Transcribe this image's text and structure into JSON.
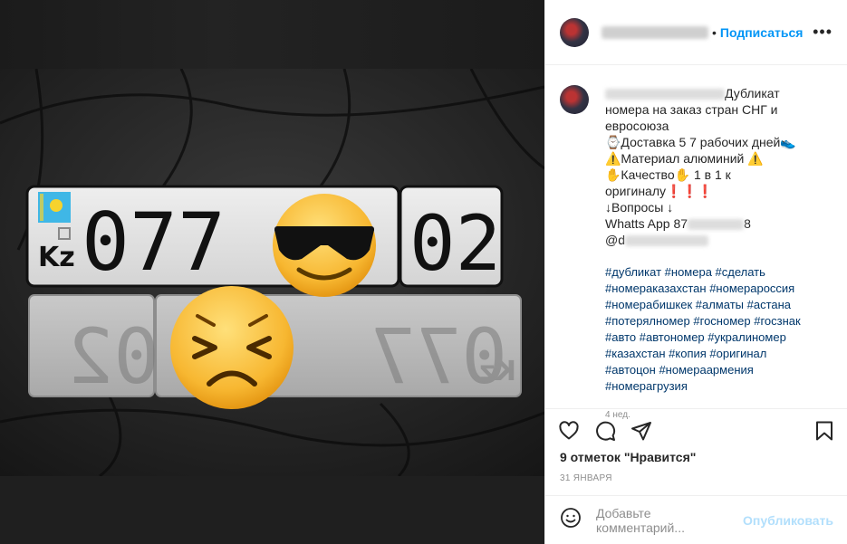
{
  "header": {
    "follow_label": "Подписаться",
    "more_label": "•••",
    "separator": "•"
  },
  "photo": {
    "plate_top_left": "Kz",
    "plate_top_main": "077",
    "plate_top_region": "02",
    "plate_bottom_main": "077",
    "plate_bottom_region": "02",
    "plate_bottom_country": "Kz",
    "emoji_top": "😎",
    "emoji_bottom": "😣"
  },
  "caption": {
    "line1": "Дубликат",
    "line2": "номера на заказ стран СНГ и",
    "line3": "евросоюза",
    "line4": "⌚Доставка 5 7 рабочих дней👟",
    "line5": "⚠️Материал алюминий ⚠️",
    "line6": "✋Качество✋ 1 в 1 к оригиналу❗❗❗",
    "line7": "↓Вопросы ↓",
    "line8_prefix": "Whatts App 87",
    "line8_suffix": "8",
    "line9_prefix": "@d"
  },
  "hashtags": [
    "#дубликат #номера #сделать",
    "#номераказахстан #номерароссия",
    "#номерабишкек #алматы #астана",
    "#потерялномер #госномер #госзнак",
    "#авто #автономер #укралиномер",
    "#казахстан #копия #оригинал",
    "#автоцон #номераармения",
    "#номерагрузия"
  ],
  "age": "4 нед.",
  "likes": "9 отметок \"Нравится\"",
  "date": "31 ЯНВАРЯ",
  "comment": {
    "placeholder": "Добавьте комментарий...",
    "post_label": "Опубликовать"
  },
  "icons": [
    "heart-icon",
    "comment-icon",
    "share-icon",
    "bookmark-icon",
    "emoji-icon"
  ],
  "colors": {
    "accent": "#0095f6",
    "hashtag": "#00376b",
    "muted": "#8e8e8e",
    "post_disabled": "#b2dffc"
  }
}
